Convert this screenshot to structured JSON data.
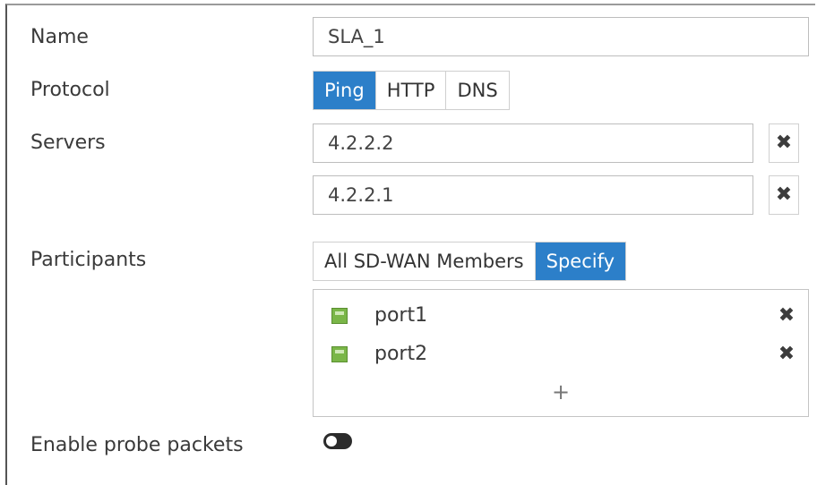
{
  "form": {
    "name_label": "Name",
    "name_value": "SLA_1",
    "protocol_label": "Protocol",
    "protocol_options": [
      "Ping",
      "HTTP",
      "DNS"
    ],
    "protocol_selected": "Ping",
    "servers_label": "Servers",
    "servers": [
      "4.2.2.2",
      "4.2.2.1"
    ],
    "participants_label": "Participants",
    "participant_modes": [
      "All SD-WAN Members",
      "Specify"
    ],
    "participant_mode_selected": "Specify",
    "participants": [
      "port1",
      "port2"
    ],
    "add_symbol": "+",
    "remove_symbol": "✖",
    "probe_label": "Enable probe packets",
    "probe_enabled": false
  },
  "colors": {
    "accent": "#2c7fc9",
    "port_icon": "#7ab648"
  },
  "icons": {
    "remove": "close-icon",
    "port": "port-icon",
    "add": "plus-icon"
  }
}
